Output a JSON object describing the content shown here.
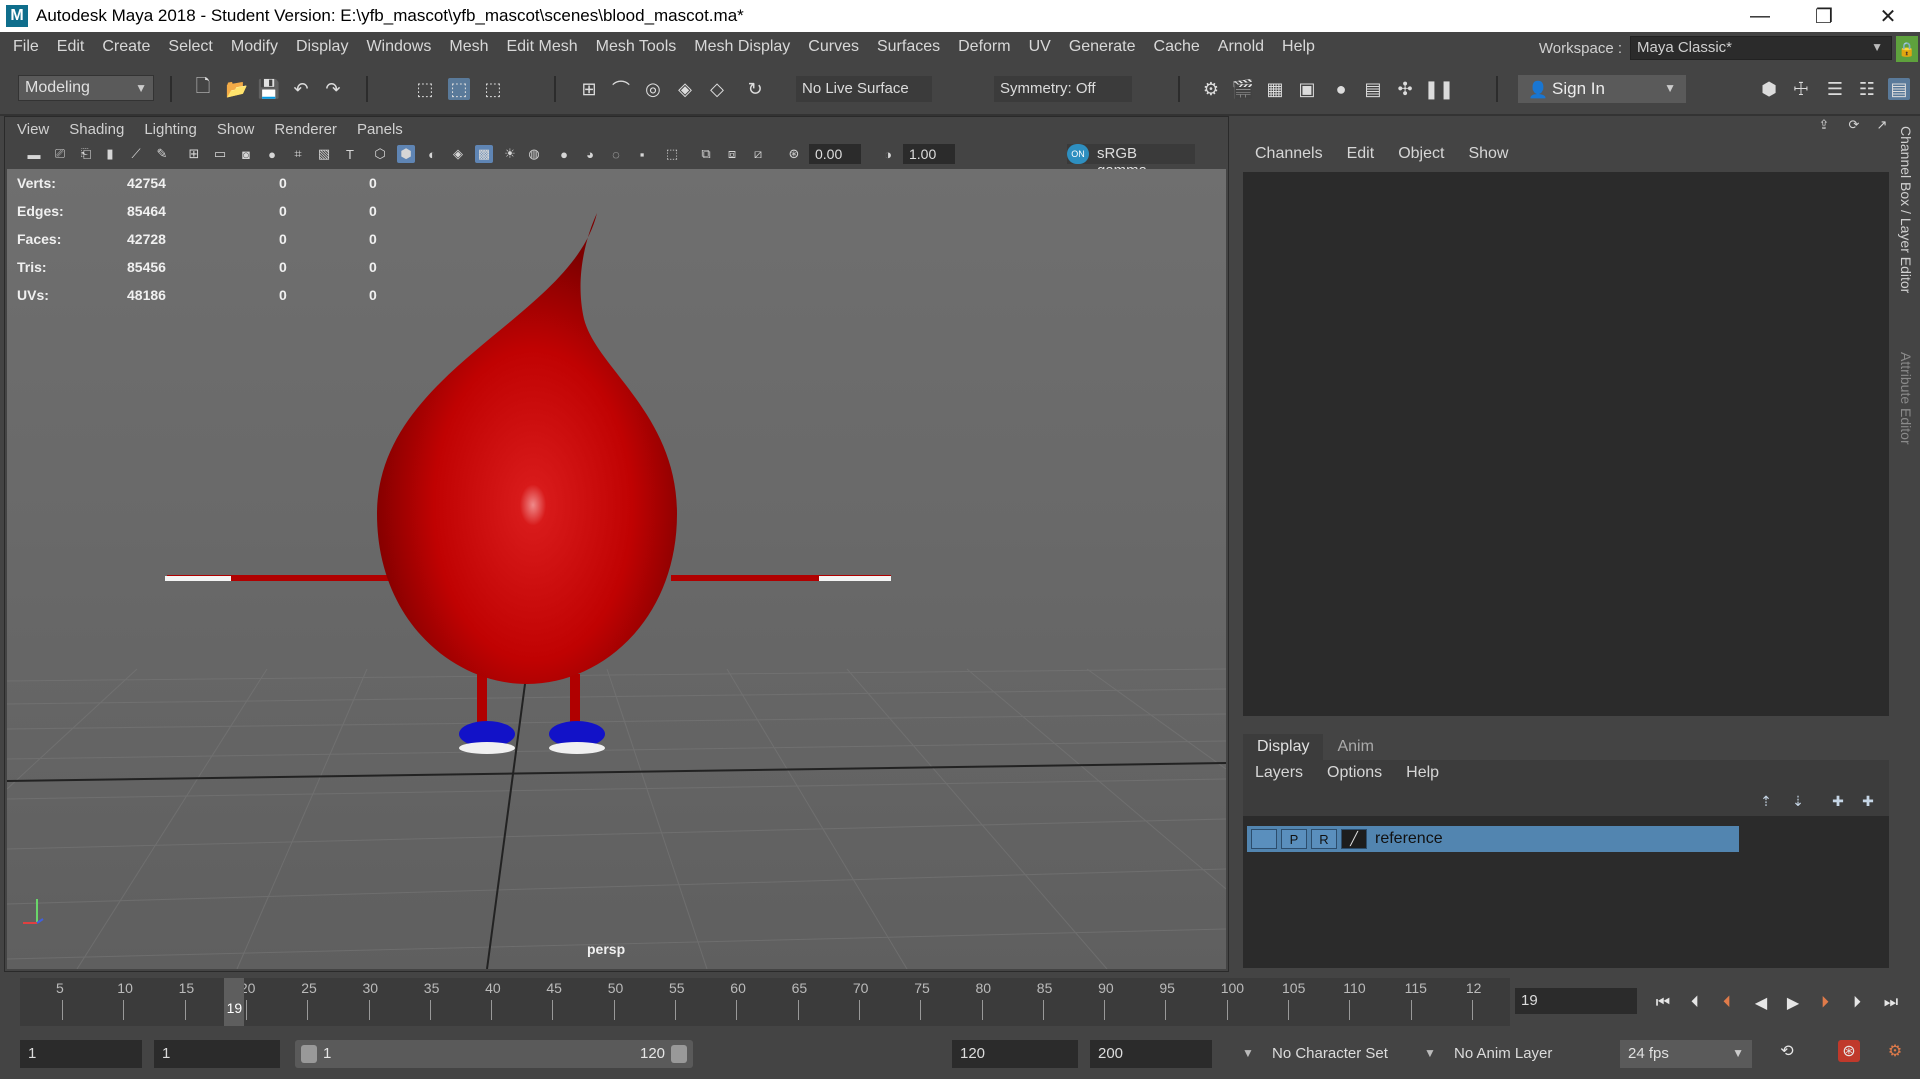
{
  "window": {
    "app_icon": "M",
    "title": "Autodesk Maya 2018 - Student Version: E:\\yfb_mascot\\yfb_mascot\\scenes\\blood_mascot.ma*",
    "minimize": "—",
    "maximize": "❐",
    "close": "✕"
  },
  "menubar": {
    "items": [
      "File",
      "Edit",
      "Create",
      "Select",
      "Modify",
      "Display",
      "Windows",
      "Mesh",
      "Edit Mesh",
      "Mesh Tools",
      "Mesh Display",
      "Curves",
      "Surfaces",
      "Deform",
      "UV",
      "Generate",
      "Cache",
      "Arnold",
      "Help"
    ],
    "workspace_label": "Workspace :",
    "workspace_value": "Maya Classic*"
  },
  "statusline": {
    "mode": "Modeling",
    "live_surface": "No Live Surface",
    "symmetry": "Symmetry: Off",
    "sign_in": "Sign In"
  },
  "viewport_panel": {
    "menu": [
      "View",
      "Shading",
      "Lighting",
      "Show",
      "Renderer",
      "Panels"
    ],
    "exposure": "0.00",
    "gamma": "1.00",
    "color_space": "sRGB gamma",
    "camera": "persp"
  },
  "hud": {
    "rows": [
      {
        "label": "Verts:",
        "total": "42754",
        "sel": "0",
        "sel2": "0"
      },
      {
        "label": "Edges:",
        "total": "85464",
        "sel": "0",
        "sel2": "0"
      },
      {
        "label": "Faces:",
        "total": "42728",
        "sel": "0",
        "sel2": "0"
      },
      {
        "label": "Tris:",
        "total": "85456",
        "sel": "0",
        "sel2": "0"
      },
      {
        "label": "UVs:",
        "total": "48186",
        "sel": "0",
        "sel2": "0"
      }
    ]
  },
  "channel_box": {
    "menu": [
      "Channels",
      "Edit",
      "Object",
      "Show"
    ]
  },
  "layer_editor": {
    "tabs": [
      "Display",
      "Anim"
    ],
    "menu": [
      "Layers",
      "Options",
      "Help"
    ],
    "layer": {
      "visible": "",
      "p": "P",
      "r": "R",
      "name": "reference"
    }
  },
  "side_tabs": [
    "Channel Box / Layer Editor",
    "Attribute Editor"
  ],
  "time_slider": {
    "ticks": [
      "5",
      "10",
      "15",
      "20",
      "25",
      "30",
      "35",
      "40",
      "45",
      "50",
      "55",
      "60",
      "65",
      "70",
      "75",
      "80",
      "85",
      "90",
      "95",
      "100",
      "105",
      "110",
      "115",
      "12"
    ],
    "current_frame": "19",
    "frame_field": "19"
  },
  "range_slider": {
    "start_time": "1",
    "range_start": "1",
    "range_inner_start": "1",
    "range_inner_end": "120",
    "range_end": "120",
    "end_time": "200",
    "character_set": "No Character Set",
    "anim_layer": "No Anim Layer",
    "fps": "24 fps"
  }
}
